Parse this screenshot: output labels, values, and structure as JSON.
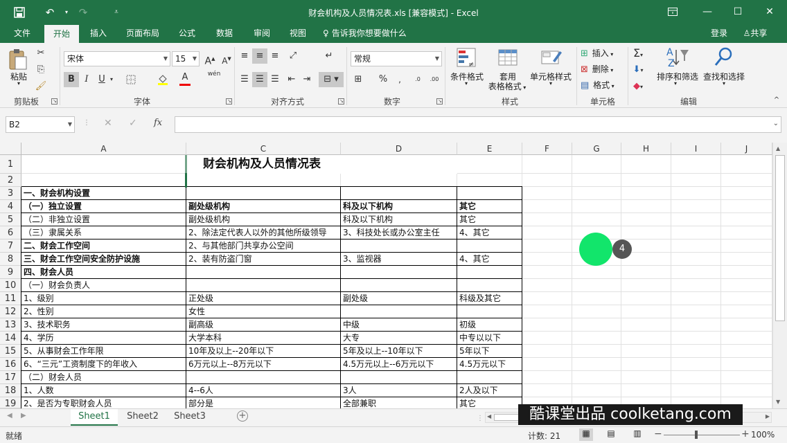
{
  "title": "财会机构及人员情况表.xls  [兼容模式] - Excel",
  "quick_access": {
    "save": "save-icon",
    "undo": "undo-icon",
    "redo": "redo-icon",
    "customize": "customize-icon"
  },
  "window": {
    "ribbon_display": "ribbon-display-icon",
    "minimize": "minimize-icon",
    "maximize": "maximize-icon",
    "close": "close-icon"
  },
  "menu": {
    "tabs": [
      "文件",
      "开始",
      "插入",
      "页面布局",
      "公式",
      "数据",
      "审阅",
      "视图"
    ],
    "active": "开始",
    "tell_me": "告诉我你想要做什么",
    "login": "登录",
    "share": "共享"
  },
  "ribbon": {
    "clipboard": {
      "paste": "粘贴",
      "label": "剪贴板"
    },
    "font": {
      "name": "宋体",
      "size": "15",
      "bold": "B",
      "italic": "I",
      "underline": "U",
      "font_color_glyph": "A",
      "wen": "wén",
      "label": "字体"
    },
    "alignment": {
      "label": "对齐方式"
    },
    "number": {
      "format": "常规",
      "label": "数字"
    },
    "styles": {
      "conditional": "条件格式",
      "table_fmt_1": "套用",
      "table_fmt_2": "表格格式",
      "cell_styles": "单元格样式",
      "label": "样式"
    },
    "cells": {
      "insert": "插入",
      "delete": "删除",
      "format": "格式",
      "label": "单元格"
    },
    "editing": {
      "sort_filter": "排序和筛选",
      "find_select": "查找和选择",
      "label": "编辑"
    }
  },
  "formula_bar": {
    "name_box": "B2",
    "fx": "fx",
    "content": ""
  },
  "columns": [
    "A",
    "C",
    "D",
    "E",
    "F",
    "G",
    "H",
    "I",
    "J"
  ],
  "rows": [
    {
      "n": "1",
      "a": "",
      "c": "财会机构及人员情况表",
      "d": "",
      "e": ""
    },
    {
      "n": "2",
      "a": "",
      "c": "",
      "d": "",
      "e": ""
    },
    {
      "n": "3",
      "a": "一、财会机构设置",
      "c": "",
      "d": "",
      "e": ""
    },
    {
      "n": "4",
      "a": "（一）独立设置",
      "c": "副处级机构",
      "d": "科及以下机构",
      "e": "其它"
    },
    {
      "n": "5",
      "a": "（二）非独立设置",
      "c": "副处级机构",
      "d": "科及以下机构",
      "e": "其它"
    },
    {
      "n": "6",
      "a": "（三）隶属关系",
      "c": "2、除法定代表人以外的其他所级领导",
      "d": "3、科技处长或办公室主任",
      "e": "4、其它"
    },
    {
      "n": "7",
      "a": "二、财会工作空间",
      "c": "2、与其他部门共享办公空间",
      "d": "",
      "e": ""
    },
    {
      "n": "8",
      "a": "三、财会工作空间安全防护设施",
      "c": "2、装有防盗门窗",
      "d": "3、监视器",
      "e": "4、其它"
    },
    {
      "n": "9",
      "a": "四、财会人员",
      "c": "",
      "d": "",
      "e": ""
    },
    {
      "n": "10",
      "a": "（一）财会负责人",
      "c": "",
      "d": "",
      "e": ""
    },
    {
      "n": "11",
      "a": "1、级别",
      "c": "正处级",
      "d": "副处级",
      "e": "科级及其它"
    },
    {
      "n": "12",
      "a": "2、性别",
      "c": "女性",
      "d": "",
      "e": ""
    },
    {
      "n": "13",
      "a": "3、技术职务",
      "c": "副高级",
      "d": "中级",
      "e": "初级"
    },
    {
      "n": "14",
      "a": "4、学历",
      "c": "大学本科",
      "d": "大专",
      "e": "中专以以下"
    },
    {
      "n": "15",
      "a": "5、从事财会工作年限",
      "c": "10年及以上--20年以下",
      "d": "5年及以上--10年以下",
      "e": "5年以下"
    },
    {
      "n": "16",
      "a": "6、“三元”工资制度下的年收入",
      "c": "6万元以上--8万元以下",
      "d": "4.5万元以上--6万元以下",
      "e": "4.5万元以下"
    },
    {
      "n": "17",
      "a": "（二）财会人员",
      "c": "",
      "d": "",
      "e": ""
    },
    {
      "n": "18",
      "a": "1、人数",
      "c": "4--6人",
      "d": "3人",
      "e": "2人及以下"
    },
    {
      "n": "19",
      "a": "2、是否为专职财会人员",
      "c": "部分是",
      "d": "全部兼职",
      "e": "其它"
    }
  ],
  "click_marker": "4",
  "sheets": [
    "Sheet1",
    "Sheet2",
    "Sheet3"
  ],
  "active_sheet": "Sheet1",
  "watermark": "酷课堂出品 coolketang.com",
  "status": {
    "ready": "就绪",
    "count": "计数: 21",
    "zoom": "100%"
  }
}
